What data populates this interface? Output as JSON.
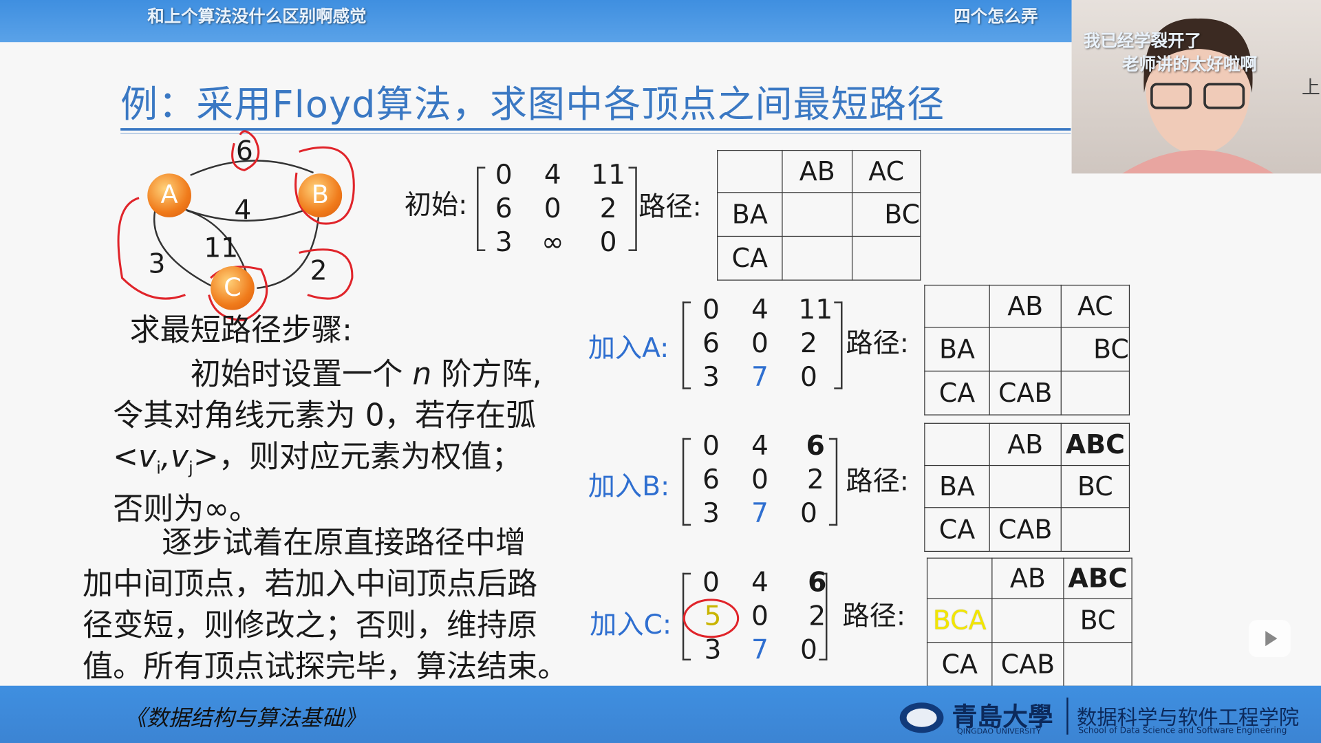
{
  "danmaku": {
    "top_left": "和上个算法没什么区别啊感觉",
    "top_right": "四个怎么弄",
    "cam1": "我已经学裂开了",
    "cam2": "老师讲的太好啦啊"
  },
  "title": "例：采用Floyd算法，求图中各顶点之间最短路径",
  "graph": {
    "nodes": [
      "A",
      "B",
      "C"
    ],
    "weights": [
      "6",
      "4",
      "11",
      "3",
      "2"
    ]
  },
  "steps": [
    {
      "label": "初始:",
      "matrix": [
        [
          "0",
          "4",
          "11"
        ],
        [
          "6",
          "0",
          "2"
        ],
        [
          "3",
          "∞",
          "0"
        ]
      ],
      "path_label": "路径:",
      "paths": [
        [
          "",
          "AB",
          "AC"
        ],
        [
          "BA",
          "",
          "BC"
        ],
        [
          "CA",
          "",
          ""
        ]
      ]
    },
    {
      "label": "加入A:",
      "matrix": [
        [
          "0",
          "4",
          "11"
        ],
        [
          "6",
          "0",
          "2"
        ],
        [
          "3",
          "7",
          "0"
        ]
      ],
      "path_label": "路径:",
      "paths": [
        [
          "",
          "AB",
          "AC"
        ],
        [
          "BA",
          "",
          "BC"
        ],
        [
          "CA",
          "CAB",
          ""
        ]
      ]
    },
    {
      "label": "加入B:",
      "matrix": [
        [
          "0",
          "4",
          "6"
        ],
        [
          "6",
          "0",
          "2"
        ],
        [
          "3",
          "7",
          "0"
        ]
      ],
      "path_label": "路径:",
      "paths": [
        [
          "",
          "AB",
          "ABC"
        ],
        [
          "BA",
          "",
          "BC"
        ],
        [
          "CA",
          "CAB",
          ""
        ]
      ]
    },
    {
      "label": "加入C:",
      "matrix": [
        [
          "0",
          "4",
          "6"
        ],
        [
          "5",
          "0",
          "2"
        ],
        [
          "3",
          "7",
          "0"
        ]
      ],
      "path_label": "路径:",
      "paths": [
        [
          "",
          "AB",
          "ABC"
        ],
        [
          "BCA",
          "",
          "BC"
        ],
        [
          "CA",
          "CAB",
          ""
        ]
      ]
    }
  ],
  "text": {
    "heading": "求最短路径步骤:",
    "p1": [
      "初始时设置一个",
      "n",
      "阶方阵,",
      "令其对角线元素为 0，若存在弧",
      "<v",
      "i",
      ",v",
      "j",
      ">，则对应元素为权值；",
      "否则为∞。"
    ],
    "p2": [
      "逐步试着在原直接路径中增",
      "加中间顶点，若加入中间顶点后路",
      "径变短，则修改之；否则，维持原",
      "值。所有顶点试探完毕，算法结束。"
    ]
  },
  "footer": {
    "book": "《数据结构与算法基础》",
    "school": "青島大學",
    "school_en": "QINGDAO UNIVERSITY",
    "college": "数据科学与软件工程学院",
    "college_en": "School of Data Science and Software Engineering"
  },
  "side_text": "上",
  "colors": {
    "blue": "#2f6fd0",
    "highlight": "#f2e600",
    "topbar": "#3f8fe0"
  }
}
